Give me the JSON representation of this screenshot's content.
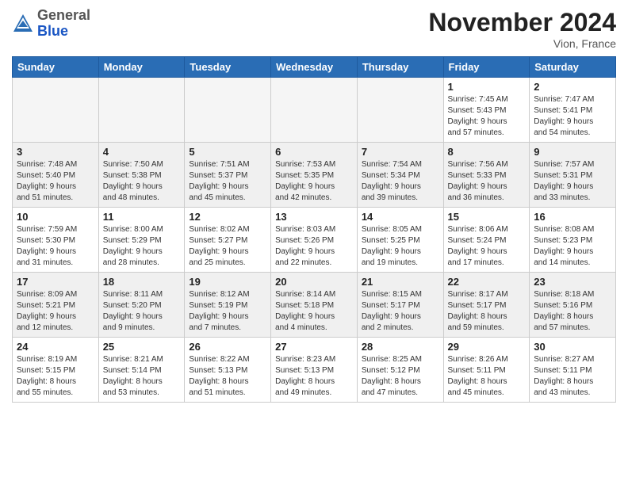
{
  "header": {
    "logo_line1": "General",
    "logo_line2": "Blue",
    "month": "November 2024",
    "location": "Vion, France"
  },
  "weekdays": [
    "Sunday",
    "Monday",
    "Tuesday",
    "Wednesday",
    "Thursday",
    "Friday",
    "Saturday"
  ],
  "weeks": [
    [
      {
        "day": "",
        "info": ""
      },
      {
        "day": "",
        "info": ""
      },
      {
        "day": "",
        "info": ""
      },
      {
        "day": "",
        "info": ""
      },
      {
        "day": "",
        "info": ""
      },
      {
        "day": "1",
        "info": "Sunrise: 7:45 AM\nSunset: 5:43 PM\nDaylight: 9 hours\nand 57 minutes."
      },
      {
        "day": "2",
        "info": "Sunrise: 7:47 AM\nSunset: 5:41 PM\nDaylight: 9 hours\nand 54 minutes."
      }
    ],
    [
      {
        "day": "3",
        "info": "Sunrise: 7:48 AM\nSunset: 5:40 PM\nDaylight: 9 hours\nand 51 minutes."
      },
      {
        "day": "4",
        "info": "Sunrise: 7:50 AM\nSunset: 5:38 PM\nDaylight: 9 hours\nand 48 minutes."
      },
      {
        "day": "5",
        "info": "Sunrise: 7:51 AM\nSunset: 5:37 PM\nDaylight: 9 hours\nand 45 minutes."
      },
      {
        "day": "6",
        "info": "Sunrise: 7:53 AM\nSunset: 5:35 PM\nDaylight: 9 hours\nand 42 minutes."
      },
      {
        "day": "7",
        "info": "Sunrise: 7:54 AM\nSunset: 5:34 PM\nDaylight: 9 hours\nand 39 minutes."
      },
      {
        "day": "8",
        "info": "Sunrise: 7:56 AM\nSunset: 5:33 PM\nDaylight: 9 hours\nand 36 minutes."
      },
      {
        "day": "9",
        "info": "Sunrise: 7:57 AM\nSunset: 5:31 PM\nDaylight: 9 hours\nand 33 minutes."
      }
    ],
    [
      {
        "day": "10",
        "info": "Sunrise: 7:59 AM\nSunset: 5:30 PM\nDaylight: 9 hours\nand 31 minutes."
      },
      {
        "day": "11",
        "info": "Sunrise: 8:00 AM\nSunset: 5:29 PM\nDaylight: 9 hours\nand 28 minutes."
      },
      {
        "day": "12",
        "info": "Sunrise: 8:02 AM\nSunset: 5:27 PM\nDaylight: 9 hours\nand 25 minutes."
      },
      {
        "day": "13",
        "info": "Sunrise: 8:03 AM\nSunset: 5:26 PM\nDaylight: 9 hours\nand 22 minutes."
      },
      {
        "day": "14",
        "info": "Sunrise: 8:05 AM\nSunset: 5:25 PM\nDaylight: 9 hours\nand 19 minutes."
      },
      {
        "day": "15",
        "info": "Sunrise: 8:06 AM\nSunset: 5:24 PM\nDaylight: 9 hours\nand 17 minutes."
      },
      {
        "day": "16",
        "info": "Sunrise: 8:08 AM\nSunset: 5:23 PM\nDaylight: 9 hours\nand 14 minutes."
      }
    ],
    [
      {
        "day": "17",
        "info": "Sunrise: 8:09 AM\nSunset: 5:21 PM\nDaylight: 9 hours\nand 12 minutes."
      },
      {
        "day": "18",
        "info": "Sunrise: 8:11 AM\nSunset: 5:20 PM\nDaylight: 9 hours\nand 9 minutes."
      },
      {
        "day": "19",
        "info": "Sunrise: 8:12 AM\nSunset: 5:19 PM\nDaylight: 9 hours\nand 7 minutes."
      },
      {
        "day": "20",
        "info": "Sunrise: 8:14 AM\nSunset: 5:18 PM\nDaylight: 9 hours\nand 4 minutes."
      },
      {
        "day": "21",
        "info": "Sunrise: 8:15 AM\nSunset: 5:17 PM\nDaylight: 9 hours\nand 2 minutes."
      },
      {
        "day": "22",
        "info": "Sunrise: 8:17 AM\nSunset: 5:17 PM\nDaylight: 8 hours\nand 59 minutes."
      },
      {
        "day": "23",
        "info": "Sunrise: 8:18 AM\nSunset: 5:16 PM\nDaylight: 8 hours\nand 57 minutes."
      }
    ],
    [
      {
        "day": "24",
        "info": "Sunrise: 8:19 AM\nSunset: 5:15 PM\nDaylight: 8 hours\nand 55 minutes."
      },
      {
        "day": "25",
        "info": "Sunrise: 8:21 AM\nSunset: 5:14 PM\nDaylight: 8 hours\nand 53 minutes."
      },
      {
        "day": "26",
        "info": "Sunrise: 8:22 AM\nSunset: 5:13 PM\nDaylight: 8 hours\nand 51 minutes."
      },
      {
        "day": "27",
        "info": "Sunrise: 8:23 AM\nSunset: 5:13 PM\nDaylight: 8 hours\nand 49 minutes."
      },
      {
        "day": "28",
        "info": "Sunrise: 8:25 AM\nSunset: 5:12 PM\nDaylight: 8 hours\nand 47 minutes."
      },
      {
        "day": "29",
        "info": "Sunrise: 8:26 AM\nSunset: 5:11 PM\nDaylight: 8 hours\nand 45 minutes."
      },
      {
        "day": "30",
        "info": "Sunrise: 8:27 AM\nSunset: 5:11 PM\nDaylight: 8 hours\nand 43 minutes."
      }
    ]
  ]
}
